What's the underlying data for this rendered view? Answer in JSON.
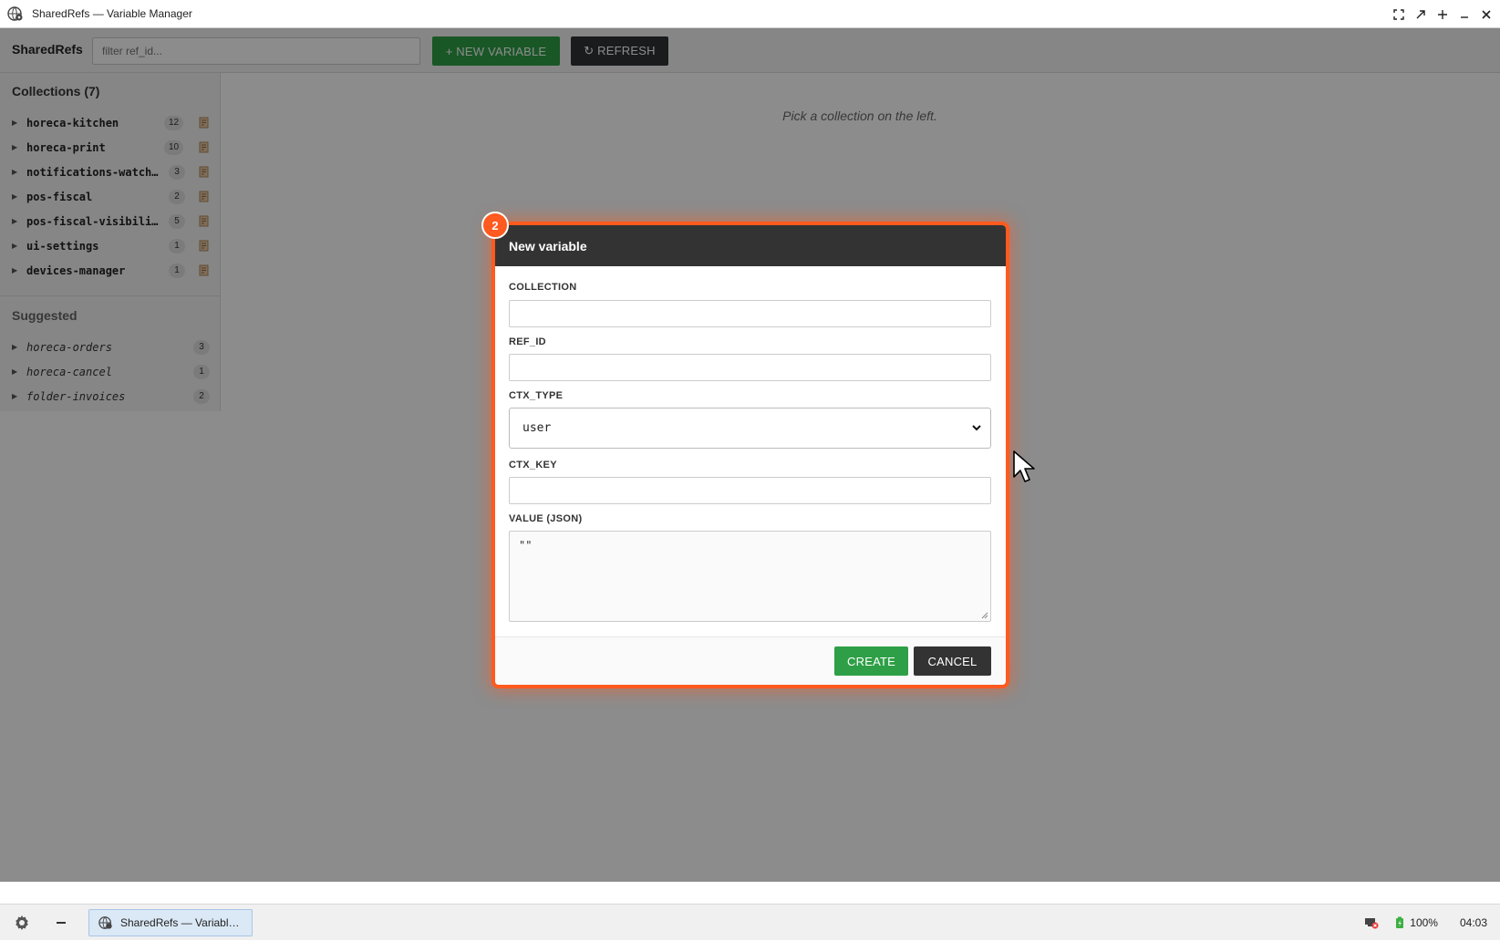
{
  "window": {
    "title": "SharedRefs — Variable Manager"
  },
  "toolbar": {
    "brand": "SharedRefs",
    "filter_placeholder": "filter ref_id...",
    "new_variable_label": "+ NEW VARIABLE",
    "refresh_label": "↻ REFRESH"
  },
  "sidebar": {
    "collections_title": "Collections (7)",
    "collections": [
      {
        "name": "horeca-kitchen",
        "count": "12"
      },
      {
        "name": "horeca-print",
        "count": "10"
      },
      {
        "name": "notifications-watch…",
        "count": "3"
      },
      {
        "name": "pos-fiscal",
        "count": "2"
      },
      {
        "name": "pos-fiscal-visibili…",
        "count": "5"
      },
      {
        "name": "ui-settings",
        "count": "1"
      },
      {
        "name": "devices-manager",
        "count": "1"
      }
    ],
    "suggested_title": "Suggested",
    "suggested": [
      {
        "name": "horeca-orders",
        "count": "3"
      },
      {
        "name": "horeca-cancel",
        "count": "1"
      },
      {
        "name": "folder-invoices",
        "count": "2"
      }
    ]
  },
  "main": {
    "empty_message": "Pick a collection on the left."
  },
  "dialog": {
    "badge": "2",
    "title": "New variable",
    "collection_label": "COLLECTION",
    "collection_value": "",
    "ref_id_label": "REF_ID",
    "ref_id_value": "",
    "ctx_type_label": "CTX_TYPE",
    "ctx_type_value": "user",
    "ctx_key_label": "CTX_KEY",
    "ctx_key_value": "",
    "value_label": "VALUE (JSON)",
    "value_text": "\"\"",
    "create_label": "CREATE",
    "cancel_label": "CANCEL"
  },
  "taskbar": {
    "task_label": "SharedRefs — Variabl…",
    "battery": "100%",
    "clock": "04:03"
  },
  "colors": {
    "accent_green": "#2e9f46",
    "highlight_orange": "#ff5a1f",
    "dark": "#333333"
  }
}
